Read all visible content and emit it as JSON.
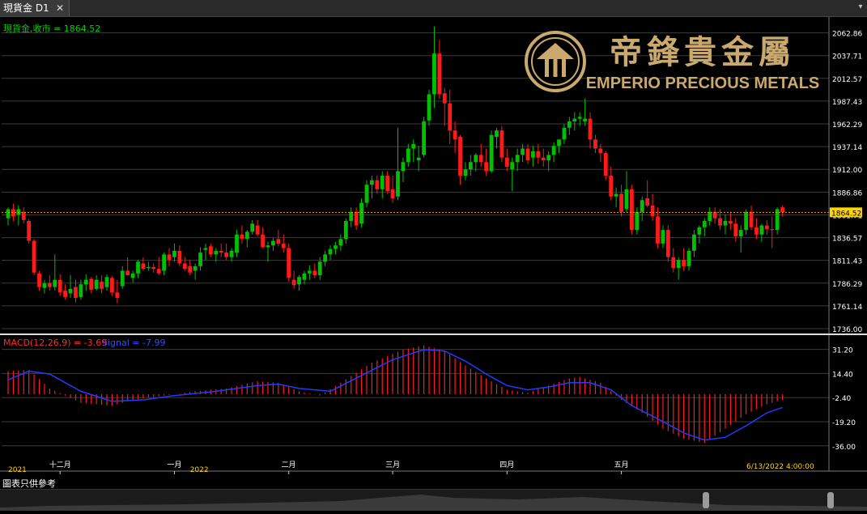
{
  "window": {
    "tab_label": "現貨金 D1",
    "close_glyph": "✕",
    "menu_glyph": "▾"
  },
  "footer": {
    "note": "圖表只供參考"
  },
  "logo": {
    "chinese": "帝鋒貴金屬",
    "english": "EMPERIO PRECIOUS METALS"
  },
  "colors": {
    "up": "#00c000",
    "down": "#ff1a1a",
    "grid": "#3b3b3b",
    "axis_text": "#ffffff",
    "signal": "#1e3cff",
    "gold": "#c9a96e",
    "price_line": "#ff9900",
    "tag_bg": "#ffd400"
  },
  "chart_data": [
    {
      "type": "candlestick",
      "label": "現貨金,收市 = 1864.52",
      "last_price": 1864.52,
      "ylim": [
        1736.0,
        2075.0
      ],
      "y_ticks": [
        2062.86,
        2037.71,
        2012.57,
        1987.43,
        1962.29,
        1937.14,
        1912.0,
        1886.86,
        1861.71,
        1836.57,
        1811.43,
        1786.29,
        1761.14,
        1736.0
      ],
      "grid": true,
      "x_tick_labels": [
        {
          "index": 10,
          "label": "十二月"
        },
        {
          "index": 32,
          "label": "一月"
        },
        {
          "index": 54,
          "label": "二月"
        },
        {
          "index": 74,
          "label": "三月"
        },
        {
          "index": 96,
          "label": "四月"
        },
        {
          "index": 118,
          "label": "五月"
        }
      ],
      "year_labels": [
        {
          "index": 0,
          "label": "2021"
        },
        {
          "index": 35,
          "label": "2022"
        }
      ],
      "timestamp": "6/13/2022 4:00:00",
      "candles": [
        [
          1858,
          1870,
          1850,
          1868
        ],
        [
          1868,
          1874,
          1855,
          1860
        ],
        [
          1862,
          1872,
          1850,
          1868
        ],
        [
          1865,
          1870,
          1852,
          1856
        ],
        [
          1855,
          1857,
          1830,
          1833
        ],
        [
          1833,
          1835,
          1795,
          1798
        ],
        [
          1797,
          1800,
          1778,
          1782
        ],
        [
          1781,
          1790,
          1775,
          1786
        ],
        [
          1786,
          1795,
          1778,
          1782
        ],
        [
          1782,
          1818,
          1778,
          1790
        ],
        [
          1790,
          1796,
          1772,
          1776
        ],
        [
          1778,
          1785,
          1768,
          1771
        ],
        [
          1775,
          1795,
          1770,
          1780
        ],
        [
          1782,
          1790,
          1765,
          1770
        ],
        [
          1771,
          1790,
          1768,
          1785
        ],
        [
          1785,
          1796,
          1778,
          1790
        ],
        [
          1791,
          1793,
          1775,
          1779
        ],
        [
          1780,
          1795,
          1778,
          1790
        ],
        [
          1788,
          1795,
          1775,
          1780
        ],
        [
          1782,
          1796,
          1778,
          1793
        ],
        [
          1792,
          1794,
          1772,
          1776
        ],
        [
          1776,
          1790,
          1764,
          1770
        ],
        [
          1783,
          1805,
          1780,
          1800
        ],
        [
          1800,
          1815,
          1795,
          1795
        ],
        [
          1792,
          1800,
          1787,
          1797
        ],
        [
          1797,
          1812,
          1792,
          1810
        ],
        [
          1808,
          1815,
          1800,
          1802
        ],
        [
          1803,
          1810,
          1800,
          1804
        ],
        [
          1804,
          1808,
          1798,
          1802
        ],
        [
          1802,
          1815,
          1795,
          1797
        ],
        [
          1800,
          1820,
          1795,
          1818
        ],
        [
          1818,
          1825,
          1805,
          1812
        ],
        [
          1815,
          1830,
          1810,
          1822
        ],
        [
          1822,
          1828,
          1805,
          1808
        ],
        [
          1808,
          1815,
          1800,
          1802
        ],
        [
          1805,
          1812,
          1795,
          1798
        ],
        [
          1800,
          1808,
          1790,
          1805
        ],
        [
          1805,
          1826,
          1800,
          1820
        ],
        [
          1823,
          1830,
          1812,
          1825
        ],
        [
          1827,
          1830,
          1815,
          1818
        ],
        [
          1818,
          1825,
          1810,
          1822
        ],
        [
          1822,
          1830,
          1815,
          1820
        ],
        [
          1820,
          1830,
          1812,
          1815
        ],
        [
          1815,
          1825,
          1810,
          1822
        ],
        [
          1820,
          1845,
          1815,
          1840
        ],
        [
          1840,
          1850,
          1830,
          1835
        ],
        [
          1835,
          1845,
          1826,
          1843
        ],
        [
          1843,
          1856,
          1840,
          1852
        ],
        [
          1850,
          1856,
          1838,
          1840
        ],
        [
          1840,
          1848,
          1825,
          1826
        ],
        [
          1826,
          1832,
          1810,
          1828
        ],
        [
          1828,
          1836,
          1822,
          1833
        ],
        [
          1835,
          1845,
          1827,
          1830
        ],
        [
          1830,
          1840,
          1820,
          1825
        ],
        [
          1825,
          1830,
          1788,
          1792
        ],
        [
          1790,
          1800,
          1780,
          1784
        ],
        [
          1785,
          1795,
          1778,
          1793
        ],
        [
          1790,
          1800,
          1785,
          1797
        ],
        [
          1797,
          1806,
          1790,
          1800
        ],
        [
          1800,
          1808,
          1792,
          1795
        ],
        [
          1795,
          1815,
          1790,
          1810
        ],
        [
          1810,
          1822,
          1805,
          1818
        ],
        [
          1818,
          1828,
          1812,
          1824
        ],
        [
          1824,
          1832,
          1818,
          1828
        ],
        [
          1828,
          1840,
          1822,
          1835
        ],
        [
          1835,
          1858,
          1830,
          1855
        ],
        [
          1855,
          1870,
          1848,
          1865
        ],
        [
          1865,
          1870,
          1845,
          1850
        ],
        [
          1852,
          1880,
          1848,
          1875
        ],
        [
          1875,
          1900,
          1870,
          1895
        ],
        [
          1895,
          1905,
          1880,
          1900
        ],
        [
          1900,
          1905,
          1885,
          1890
        ],
        [
          1890,
          1910,
          1880,
          1905
        ],
        [
          1905,
          1910,
          1885,
          1888
        ],
        [
          1890,
          1905,
          1875,
          1880
        ],
        [
          1882,
          1958,
          1878,
          1910
        ],
        [
          1910,
          1925,
          1898,
          1920
        ],
        [
          1920,
          1940,
          1915,
          1935
        ],
        [
          1935,
          1945,
          1920,
          1940
        ],
        [
          1922,
          1938,
          1910,
          1925
        ],
        [
          1928,
          1970,
          1925,
          1965
        ],
        [
          1966,
          2000,
          1960,
          1995
        ],
        [
          1995,
          2070,
          1980,
          2040
        ],
        [
          2040,
          2055,
          1990,
          1995
        ],
        [
          1996,
          2002,
          1960,
          1985
        ],
        [
          1985,
          2000,
          1940,
          1955
        ],
        [
          1955,
          1965,
          1930,
          1945
        ],
        [
          1948,
          1950,
          1895,
          1905
        ],
        [
          1905,
          1920,
          1900,
          1912
        ],
        [
          1912,
          1928,
          1905,
          1920
        ],
        [
          1920,
          1930,
          1910,
          1928
        ],
        [
          1928,
          1940,
          1915,
          1920
        ],
        [
          1920,
          1935,
          1905,
          1910
        ],
        [
          1910,
          1955,
          1908,
          1950
        ],
        [
          1948,
          1958,
          1935,
          1955
        ],
        [
          1955,
          1960,
          1920,
          1925
        ],
        [
          1925,
          1935,
          1910,
          1915
        ],
        [
          1912,
          1925,
          1888,
          1920
        ],
        [
          1920,
          1935,
          1910,
          1928
        ],
        [
          1928,
          1940,
          1920,
          1935
        ],
        [
          1935,
          1940,
          1918,
          1922
        ],
        [
          1925,
          1938,
          1915,
          1932
        ],
        [
          1932,
          1940,
          1918,
          1925
        ],
        [
          1925,
          1935,
          1915,
          1922
        ],
        [
          1922,
          1932,
          1910,
          1928
        ],
        [
          1928,
          1942,
          1920,
          1938
        ],
        [
          1938,
          1945,
          1930,
          1945
        ],
        [
          1945,
          1962,
          1940,
          1958
        ],
        [
          1958,
          1970,
          1950,
          1965
        ],
        [
          1965,
          1975,
          1955,
          1968
        ],
        [
          1968,
          1975,
          1960,
          1970
        ],
        [
          1965,
          1990,
          1960,
          1968
        ],
        [
          1968,
          1975,
          1935,
          1945
        ],
        [
          1945,
          1950,
          1930,
          1935
        ],
        [
          1935,
          1940,
          1920,
          1930
        ],
        [
          1930,
          1932,
          1900,
          1905
        ],
        [
          1905,
          1915,
          1878,
          1882
        ],
        [
          1882,
          1892,
          1870,
          1885
        ],
        [
          1885,
          1895,
          1860,
          1865
        ],
        [
          1868,
          1910,
          1865,
          1890
        ],
        [
          1890,
          1895,
          1840,
          1845
        ],
        [
          1845,
          1870,
          1840,
          1865
        ],
        [
          1865,
          1882,
          1855,
          1878
        ],
        [
          1880,
          1900,
          1870,
          1872
        ],
        [
          1872,
          1885,
          1855,
          1860
        ],
        [
          1860,
          1870,
          1825,
          1830
        ],
        [
          1830,
          1850,
          1825,
          1845
        ],
        [
          1845,
          1850,
          1810,
          1815
        ],
        [
          1815,
          1825,
          1798,
          1803
        ],
        [
          1803,
          1815,
          1790,
          1812
        ],
        [
          1812,
          1825,
          1800,
          1805
        ],
        [
          1805,
          1825,
          1800,
          1822
        ],
        [
          1822,
          1845,
          1815,
          1840
        ],
        [
          1840,
          1850,
          1830,
          1848
        ],
        [
          1848,
          1858,
          1838,
          1855
        ],
        [
          1855,
          1870,
          1850,
          1865
        ],
        [
          1865,
          1870,
          1852,
          1858
        ],
        [
          1858,
          1868,
          1845,
          1850
        ],
        [
          1850,
          1862,
          1840,
          1855
        ],
        [
          1855,
          1865,
          1845,
          1852
        ],
        [
          1852,
          1858,
          1832,
          1838
        ],
        [
          1838,
          1850,
          1820,
          1845
        ],
        [
          1845,
          1868,
          1840,
          1865
        ],
        [
          1865,
          1872,
          1845,
          1848
        ],
        [
          1848,
          1858,
          1835,
          1840
        ],
        [
          1840,
          1852,
          1832,
          1850
        ],
        [
          1850,
          1856,
          1840,
          1846
        ],
        [
          1846,
          1860,
          1825,
          1845
        ],
        [
          1845,
          1870,
          1840,
          1868
        ],
        [
          1870,
          1872,
          1860,
          1864.52
        ]
      ]
    },
    {
      "type": "macd",
      "label": "MACD(12,26,9) = -3.69",
      "signal_label": "Signal = -7.99",
      "macd_value": -3.69,
      "signal_value": -7.99,
      "ylim": [
        -44.0,
        40.0
      ],
      "y_ticks": [
        31.2,
        14.4,
        -2.4,
        -19.2,
        -36.0
      ],
      "anchors_macd": [
        [
          0,
          16
        ],
        [
          4,
          17
        ],
        [
          8,
          4
        ],
        [
          14,
          -6
        ],
        [
          20,
          -8
        ],
        [
          24,
          -4
        ],
        [
          30,
          -1
        ],
        [
          36,
          2
        ],
        [
          42,
          4
        ],
        [
          48,
          9
        ],
        [
          52,
          8
        ],
        [
          56,
          2
        ],
        [
          60,
          -1
        ],
        [
          64,
          8
        ],
        [
          70,
          22
        ],
        [
          76,
          31
        ],
        [
          80,
          34
        ],
        [
          84,
          30
        ],
        [
          88,
          20
        ],
        [
          92,
          11
        ],
        [
          96,
          3
        ],
        [
          100,
          1
        ],
        [
          104,
          6
        ],
        [
          108,
          11
        ],
        [
          110,
          12
        ],
        [
          114,
          8
        ],
        [
          118,
          -4
        ],
        [
          122,
          -13
        ],
        [
          126,
          -24
        ],
        [
          130,
          -31
        ],
        [
          134,
          -34
        ],
        [
          138,
          -24
        ],
        [
          142,
          -14
        ],
        [
          146,
          -7
        ],
        [
          150,
          -3
        ]
      ],
      "anchors_signal": [
        [
          0,
          10
        ],
        [
          4,
          16
        ],
        [
          8,
          14
        ],
        [
          14,
          2
        ],
        [
          20,
          -5
        ],
        [
          26,
          -4
        ],
        [
          32,
          -1
        ],
        [
          40,
          2
        ],
        [
          48,
          6
        ],
        [
          52,
          7
        ],
        [
          56,
          4
        ],
        [
          62,
          2
        ],
        [
          68,
          13
        ],
        [
          74,
          24
        ],
        [
          80,
          31
        ],
        [
          84,
          30
        ],
        [
          88,
          23
        ],
        [
          92,
          14
        ],
        [
          96,
          6
        ],
        [
          100,
          3
        ],
        [
          104,
          5
        ],
        [
          108,
          8
        ],
        [
          112,
          8
        ],
        [
          116,
          3
        ],
        [
          120,
          -8
        ],
        [
          126,
          -19
        ],
        [
          130,
          -27
        ],
        [
          134,
          -32
        ],
        [
          138,
          -30
        ],
        [
          142,
          -22
        ],
        [
          146,
          -13
        ],
        [
          150,
          -8
        ]
      ]
    }
  ]
}
